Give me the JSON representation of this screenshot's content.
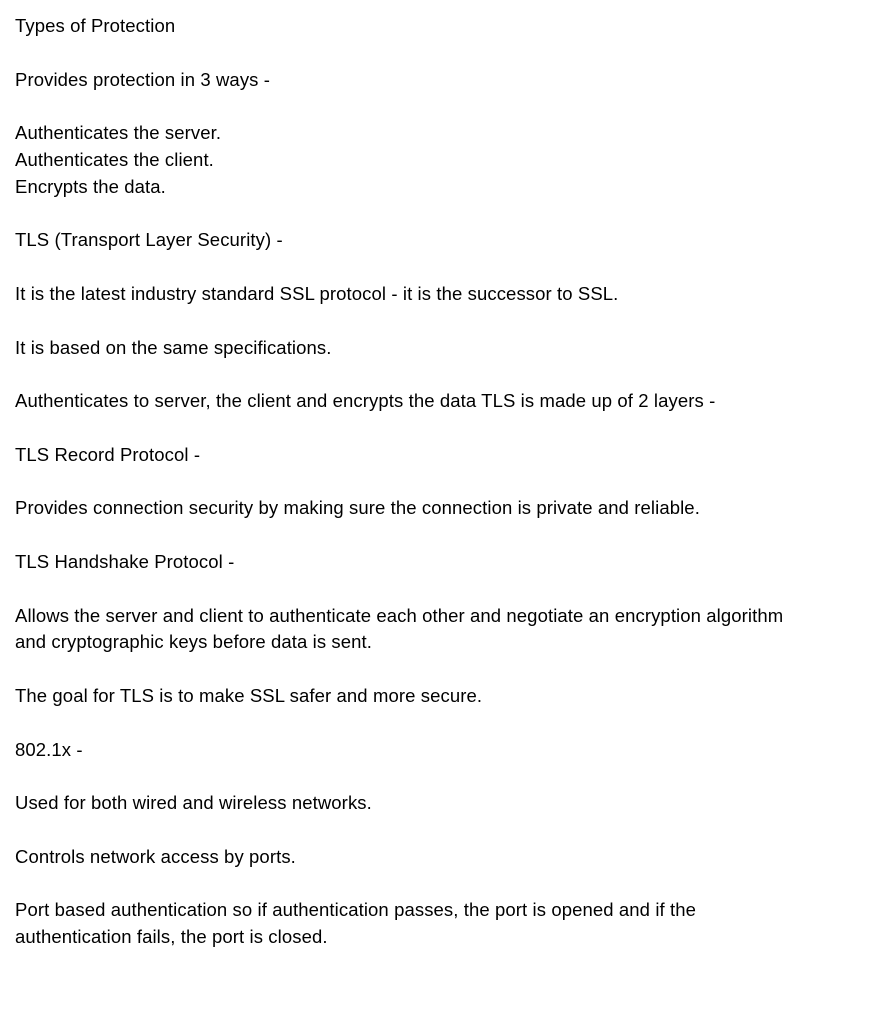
{
  "document": {
    "title": "Types of Protection",
    "intro": "Provides protection in 3 ways -",
    "ways": [
      "Authenticates the server.",
      "Authenticates the client.",
      "Encrypts the data."
    ],
    "tls_heading": "TLS (Transport Layer Security) -",
    "tls_p1": "It is the latest industry standard SSL protocol - it is the successor to SSL.",
    "tls_p2": "It is based on the same specifications.",
    "tls_p3": "Authenticates to server, the client and encrypts the data TLS is made up of 2 layers -",
    "record_heading": "TLS Record Protocol -",
    "record_p": "Provides connection security by making sure the connection is private and reliable.",
    "handshake_heading": "TLS Handshake Protocol -",
    "handshake_p_line1": "Allows the server and client to authenticate each other and negotiate an encryption algorithm",
    "handshake_p_line2": "and cryptographic keys before data is sent.",
    "tls_goal": "The goal for TLS is to make SSL safer and more secure.",
    "dot1x_heading": "802.1x -",
    "dot1x_p1": "Used for both wired and wireless networks.",
    "dot1x_p2": "Controls network access by ports.",
    "dot1x_p3_line1": "Port based authentication so if authentication passes, the port is opened and if the",
    "dot1x_p3_line2": "authentication fails, the port is closed."
  }
}
